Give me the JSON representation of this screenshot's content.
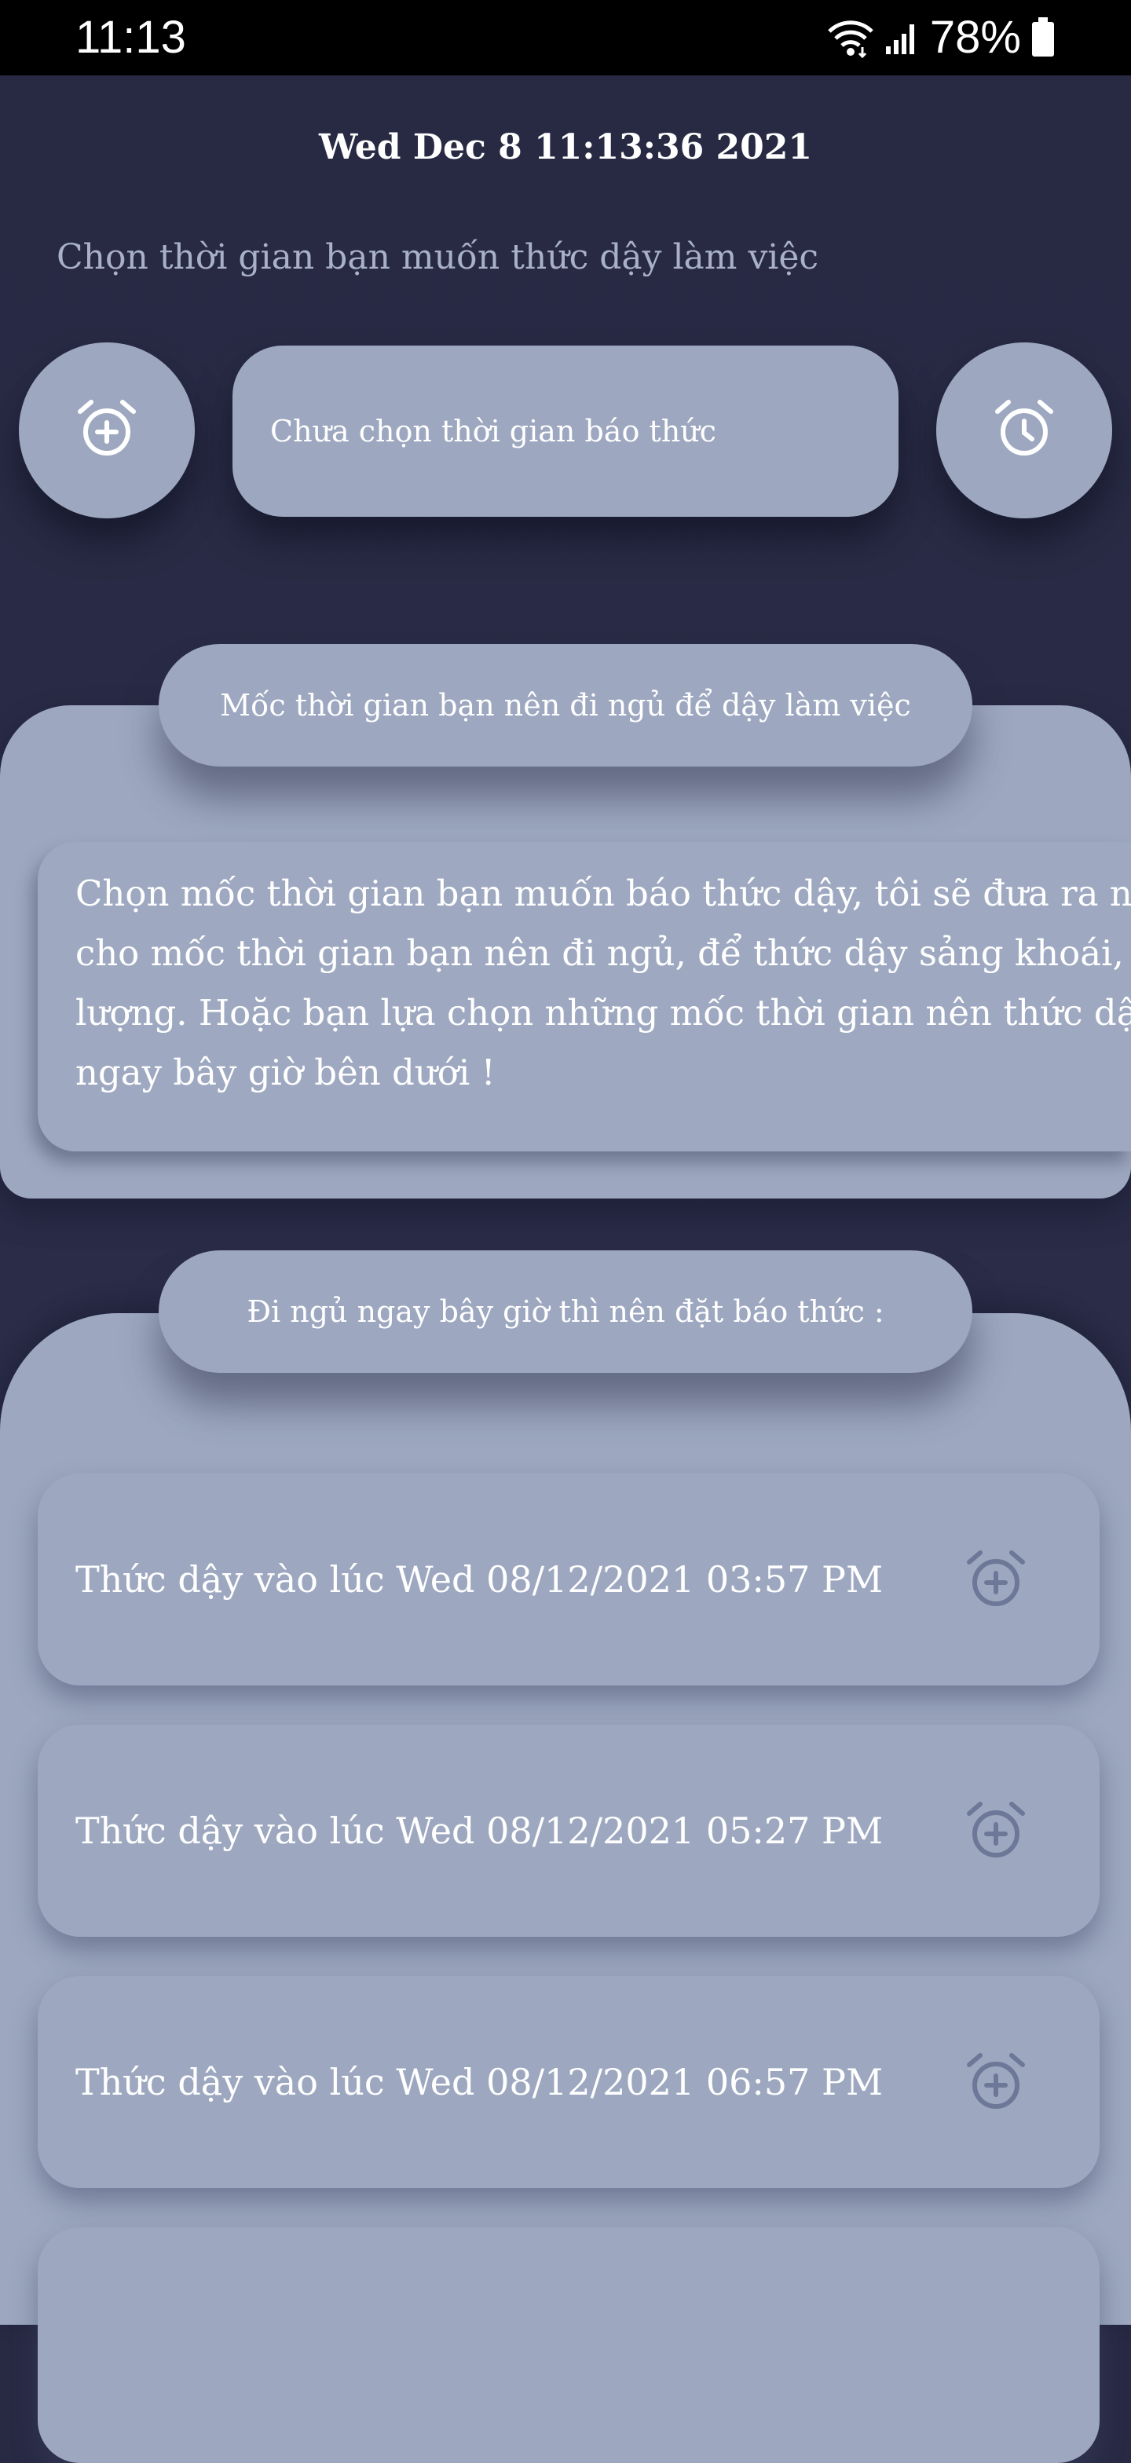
{
  "status_bar": {
    "time": "11:13",
    "battery": "78%"
  },
  "header": {
    "datetime": "Wed Dec  8 11:13:36 2021",
    "prompt": "Chọn thời gian bạn muốn thức dậy làm việc"
  },
  "alarm_picker": {
    "value": "Chưa chọn thời gian báo thức",
    "left_icon": "alarm-add-icon",
    "right_icon": "alarm-icon"
  },
  "bedtime_section": {
    "title": "Mốc thời gian bạn nên đi ngủ để dậy làm việc",
    "description": "Chọn mốc thời gian bạn muốn báo thức dậy, tôi sẽ đưa ra nhữ\ncho mốc thời gian bạn nên đi ngủ, để thức dậy sảng khoái, trà\nlượng. Hoặc bạn lựa chọn những mốc thời gian nên thức dậy\nngay bây giờ bên dưới !"
  },
  "sleep_now_section": {
    "title": "Đi ngủ ngay bây giờ thì nên đặt báo thức :",
    "items": [
      {
        "label": "Thức dậy vào lúc Wed 08/12/2021 03:57 PM",
        "icon": "alarm-add-icon"
      },
      {
        "label": "Thức dậy vào lúc Wed 08/12/2021 05:27 PM",
        "icon": "alarm-add-icon"
      },
      {
        "label": "Thức dậy vào lúc Wed 08/12/2021 06:57 PM",
        "icon": "alarm-add-icon"
      }
    ]
  },
  "colors": {
    "background": "#282a44",
    "card": "#9da8c0",
    "icon": "#6d7898",
    "text": "#ffffff"
  }
}
